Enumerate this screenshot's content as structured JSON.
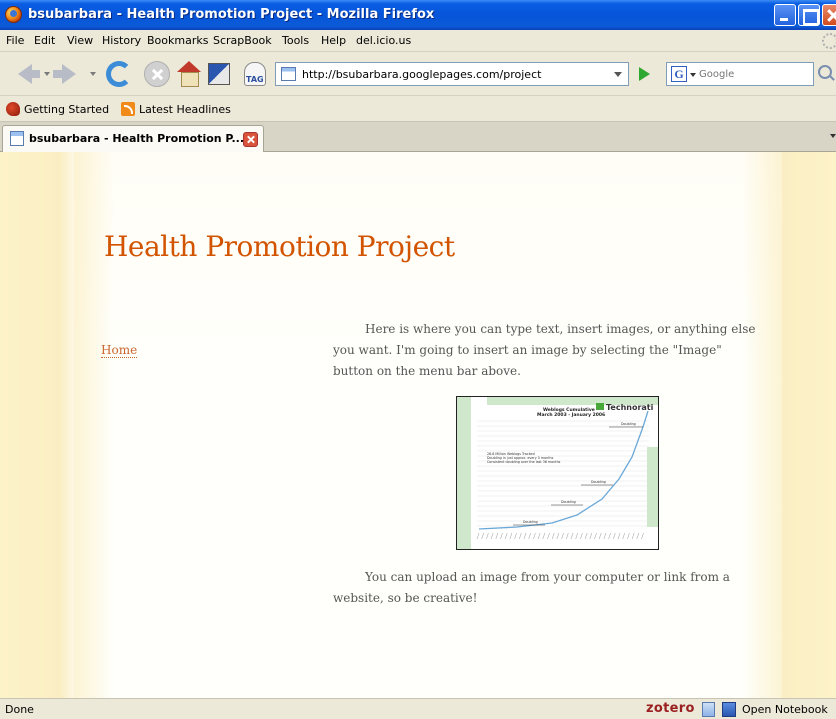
{
  "window": {
    "title": "bsubarbara - Health Promotion Project - Mozilla Firefox"
  },
  "menubar": {
    "items": [
      "File",
      "Edit",
      "View",
      "History",
      "Bookmarks",
      "ScrapBook",
      "Tools",
      "Help",
      "del.icio.us"
    ]
  },
  "toolbar": {
    "url": "http://bsubarbara.googlepages.com/project",
    "search_placeholder": "Google",
    "search_engine_icon": "G",
    "tag_label": "TAG"
  },
  "bookmarks": {
    "items": [
      "Getting Started",
      "Latest Headlines"
    ]
  },
  "tabs": [
    {
      "title": "bsubarbara - Health Promotion P..."
    }
  ],
  "page": {
    "site_title": "Health Promotion Project",
    "nav": {
      "home": "Home"
    },
    "paragraph1": "Here is where you can type text, insert images, or anything else you want. I'm going to insert an image by selecting the \"Image\" button on the menu bar above.",
    "paragraph2": "You can upload an image from your computer or link from a website, so be creative!",
    "image": {
      "title_line1": "Weblogs Cumulative",
      "title_line2": "March 2003 - January 2006",
      "brand": "Technorati",
      "notes": [
        "26.6 Million Weblogs Tracked",
        "Doubling in just approx. every 5 months",
        "Consistent doubling over the last 36 months"
      ],
      "doubling_label": "Doubling"
    }
  },
  "statusbar": {
    "status": "Done",
    "zotero": "zotero",
    "notebook": "Open Notebook"
  },
  "colors": {
    "site_title": "#d35400",
    "link": "#c9662e",
    "titlebar": "#0554d9"
  }
}
